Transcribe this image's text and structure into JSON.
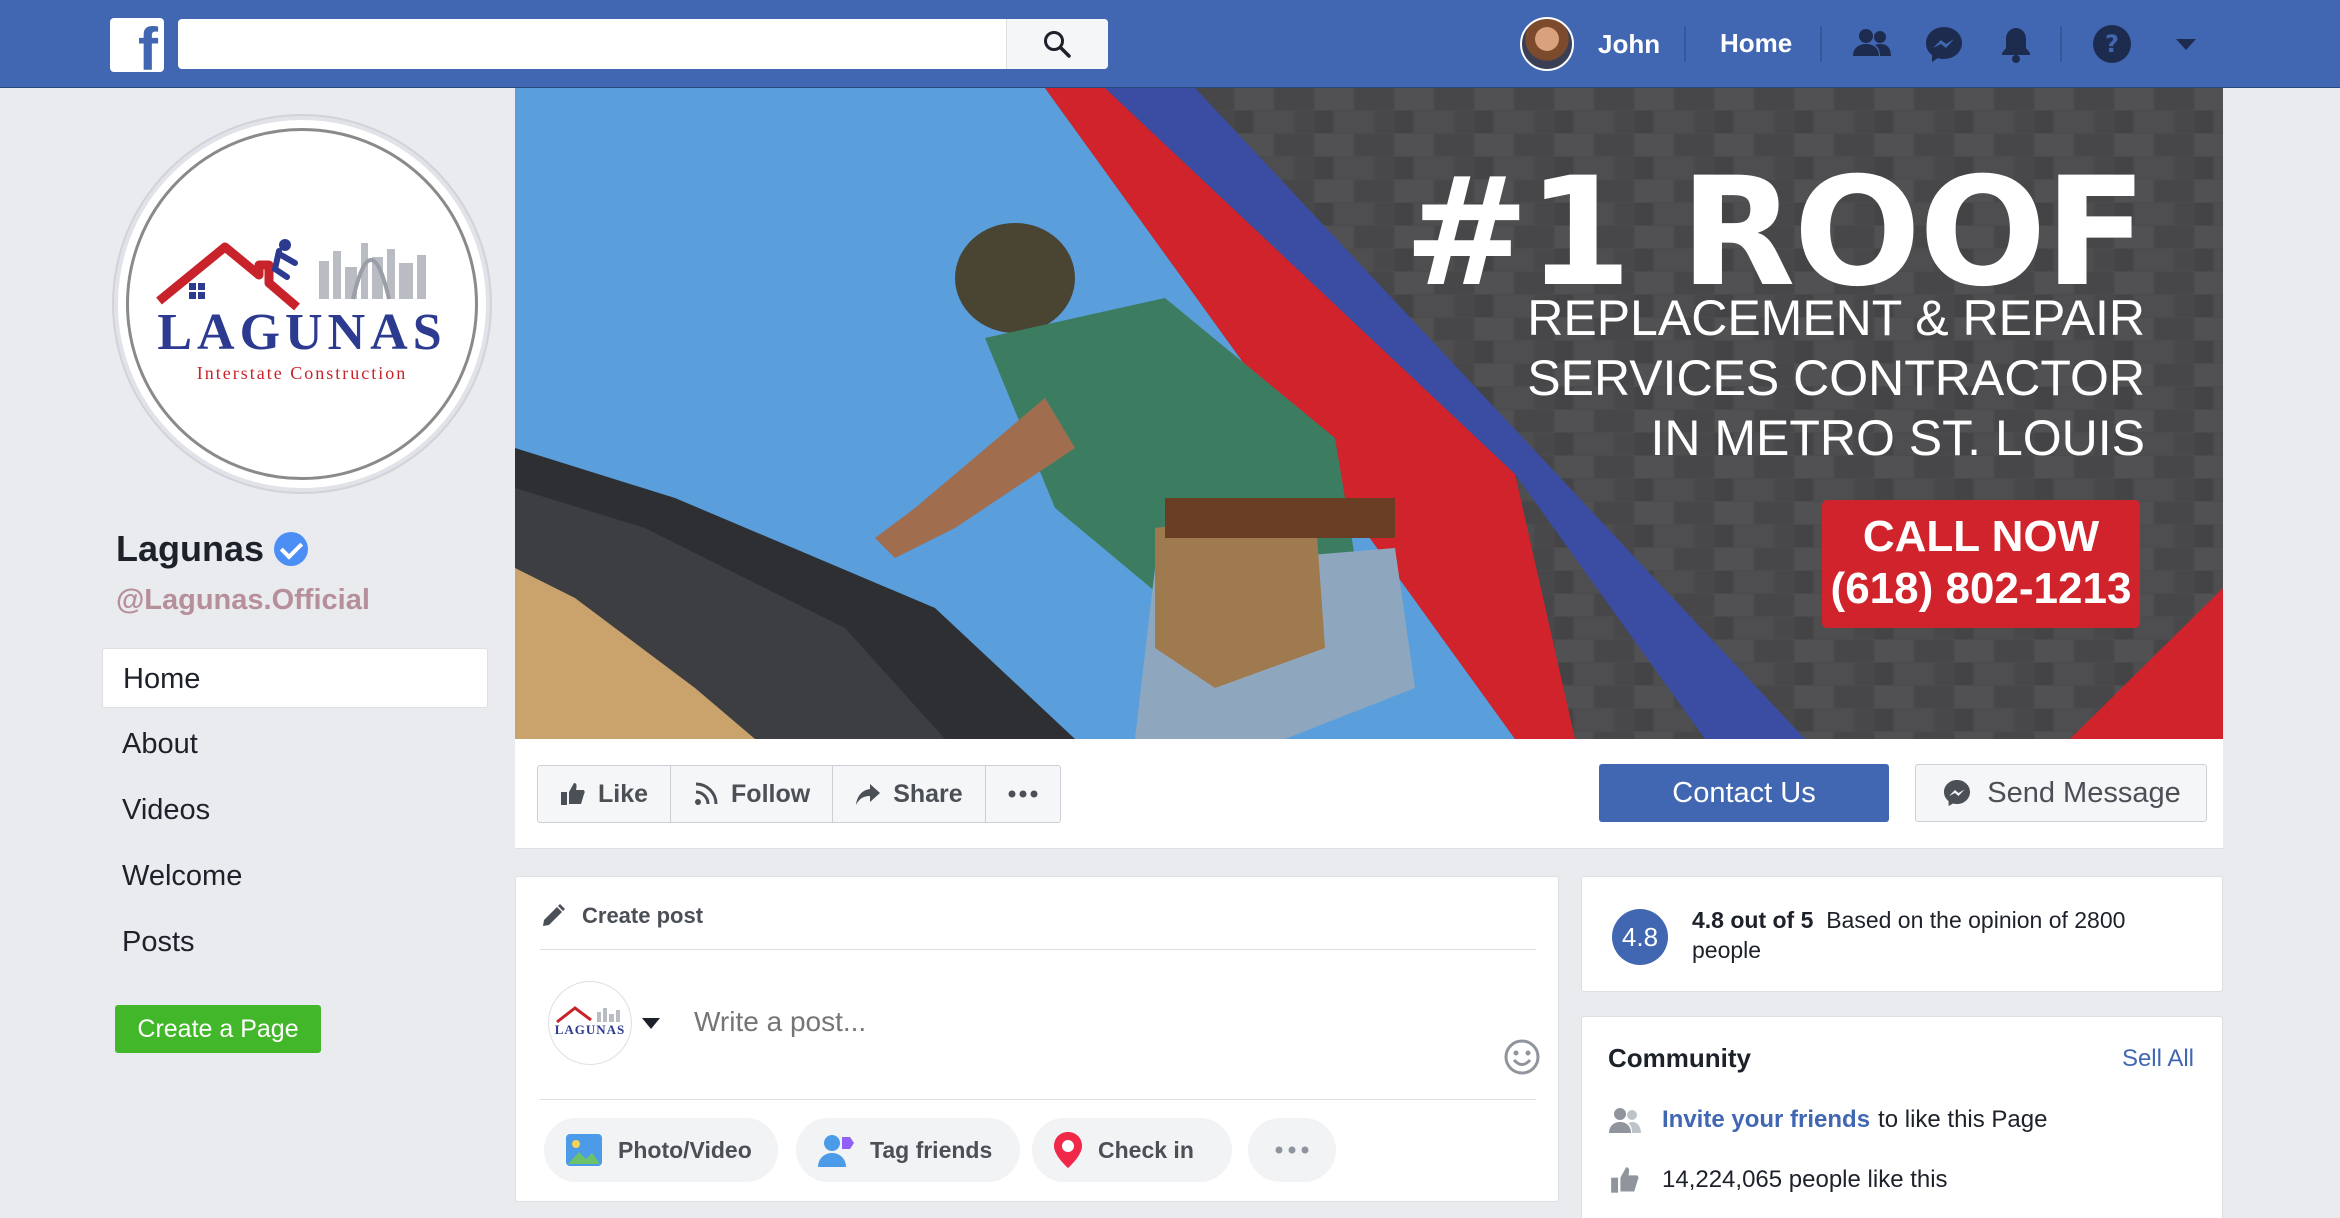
{
  "topbar": {
    "logo": "f",
    "search_placeholder": "",
    "user_name": "John",
    "home_label": "Home",
    "icons": [
      "friends-icon",
      "messenger-icon",
      "notifications-icon",
      "help-icon",
      "caret-down-icon"
    ]
  },
  "page": {
    "name": "Lagunas",
    "handle": "@Lagunas.Official",
    "logo_word": "LAGUNAS",
    "logo_sub": "Interstate Construction"
  },
  "left_nav": {
    "items": [
      {
        "label": "Home",
        "active": true
      },
      {
        "label": "About",
        "active": false
      },
      {
        "label": "Videos",
        "active": false
      },
      {
        "label": "Welcome",
        "active": false
      },
      {
        "label": "Posts",
        "active": false
      }
    ],
    "create_page_label": "Create a Page"
  },
  "cover": {
    "headline": "#1 ROOF",
    "sub_line1": "REPLACEMENT & REPAIR",
    "sub_line2": "SERVICES CONTRACTOR",
    "sub_line3": "IN METRO ST. LOUIS",
    "cta_line1": "CALL NOW",
    "cta_line2": "(618) 802-1213"
  },
  "actions": {
    "like": "Like",
    "follow": "Follow",
    "share": "Share",
    "more": "...",
    "contact": "Contact Us",
    "message": "Send Message"
  },
  "create_post": {
    "title": "Create post",
    "placeholder": "Write a post...",
    "photo_video": "Photo/Video",
    "tag_friends": "Tag friends",
    "check_in": "Check in",
    "more": "..."
  },
  "rating": {
    "score": "4.8",
    "bold_text": "4.8 out of 5",
    "text": "Based  on the opinion of 2800 people"
  },
  "community": {
    "title": "Community",
    "see_all": "Sell All",
    "invite_link": "Invite your friends",
    "invite_text": "to like this Page",
    "likes_text": "14,224,065 people like this"
  },
  "colors": {
    "brand_blue": "#4267b2",
    "accent_red": "#d0232b",
    "green": "#42b72a"
  }
}
